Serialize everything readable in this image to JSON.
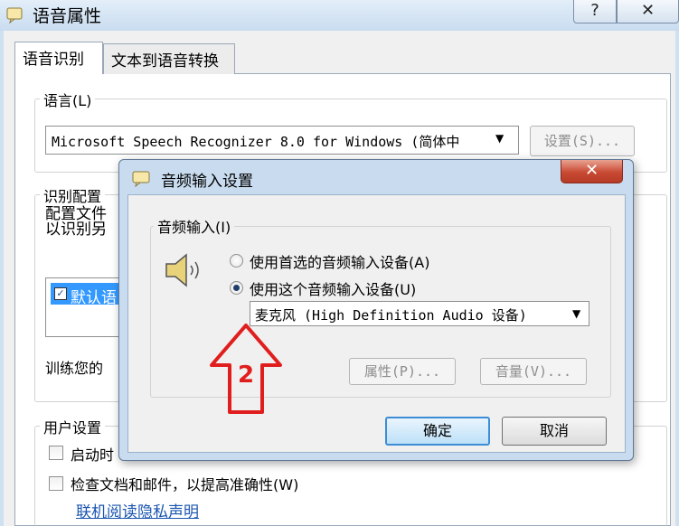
{
  "outer": {
    "title": "语音属性",
    "help_label": "?",
    "close_label": "✕",
    "tabs": [
      {
        "label": "语音识别",
        "active": true
      },
      {
        "label": "文本到语音转换",
        "active": false
      }
    ],
    "language": {
      "legend": "语言(L)",
      "engine_value": "Microsoft Speech Recognizer 8.0 for Windows (简体中",
      "settings_label": "设置(S)..."
    },
    "profiles": {
      "legend": "识别配置",
      "desc_line1": "配置文件",
      "desc_line2": "以识别另",
      "item_label": "默认语",
      "item_checked": true,
      "train_label": "训练您的"
    },
    "user_settings": {
      "legend": "用户设置",
      "startup_label": "启动时",
      "review_label": "检查文档和邮件，以提高准确性(W)",
      "privacy_link": "联机阅读隐私声明"
    }
  },
  "dialog": {
    "title": "音频输入设置",
    "close_label": "✕",
    "group_legend": "音频输入(I)",
    "radio_preferred": "使用首选的音频输入设备(A)",
    "radio_specific": "使用这个音频输入设备(U)",
    "selected_radio": "specific",
    "device_value": "麦克风 (High Definition Audio 设备)",
    "properties_label": "属性(P)...",
    "volume_label": "音量(V)...",
    "ok_label": "确定",
    "cancel_label": "取消"
  },
  "annotation": {
    "step_number": "2",
    "color": "#e01e1e"
  }
}
